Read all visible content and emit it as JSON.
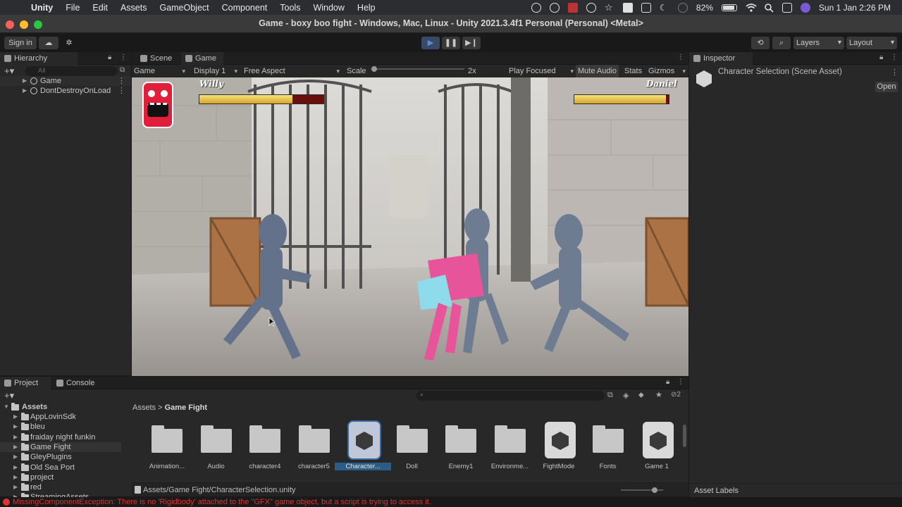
{
  "menubar": {
    "app": "Unity",
    "items": [
      "File",
      "Edit",
      "Assets",
      "GameObject",
      "Component",
      "Tools",
      "Window",
      "Help"
    ],
    "battery": "82%",
    "datetime": "Sun 1 Jan  2:26 PM"
  },
  "window": {
    "title": "Game - boxy boo fight - Windows, Mac, Linux - Unity 2021.3.4f1 Personal (Personal) <Metal>"
  },
  "toolbar": {
    "signin": "Sign in",
    "layers": "Layers",
    "layout": "Layout"
  },
  "hierarchy": {
    "tab": "Hierarchy",
    "search_placeholder": "All",
    "rows": [
      "Game",
      "DontDestroyOnLoad"
    ]
  },
  "game_view": {
    "tabs": [
      "Scene",
      "Game"
    ],
    "mode": "Game",
    "display": "Display 1",
    "aspect": "Free Aspect",
    "scale_label": "Scale",
    "scale_value": "2x",
    "play_focused": "Play Focused",
    "mute_audio": "Mute Audio",
    "stats": "Stats",
    "gizmos": "Gizmos",
    "hud": {
      "player1": "Willy",
      "player2": "Daniel",
      "player1_health": 0.75,
      "player2_health": 0.97
    }
  },
  "inspector": {
    "tab": "Inspector",
    "title": "Character Selection (Scene Asset)",
    "open_button": "Open",
    "asset_labels": "Asset Labels"
  },
  "project": {
    "tabs": [
      "Project",
      "Console"
    ],
    "hidden_count": "2",
    "tree": {
      "root": "Assets",
      "items": [
        "AppLovinSdk",
        "bleu",
        "fraiday night funkin",
        "Game Fight",
        "GleyPlugins",
        "Old Sea Port",
        "project",
        "red",
        "StreamingAssets"
      ]
    },
    "breadcrumb": [
      "Assets",
      "Game Fight"
    ],
    "assets": [
      {
        "name": "Animation...",
        "type": "folder"
      },
      {
        "name": "Audio",
        "type": "folder"
      },
      {
        "name": "character4",
        "type": "folder"
      },
      {
        "name": "character5",
        "type": "folder"
      },
      {
        "name": "Character...",
        "type": "unity",
        "selected": true
      },
      {
        "name": "Doll",
        "type": "folder"
      },
      {
        "name": "Enemy1",
        "type": "folder"
      },
      {
        "name": "Environme...",
        "type": "folder"
      },
      {
        "name": "FightMode",
        "type": "unity"
      },
      {
        "name": "Fonts",
        "type": "folder"
      },
      {
        "name": "Game 1",
        "type": "unity"
      }
    ],
    "selected_path": "Assets/Game Fight/CharacterSelection.unity"
  },
  "status": {
    "error": "MissingComponentException: There is no 'Rigidbody' attached to the \"GFX\" game object, but a script is trying to access it."
  },
  "colors": {
    "accent": "#2c5d87",
    "error": "#dd3333",
    "play": "#4d8fe0"
  }
}
